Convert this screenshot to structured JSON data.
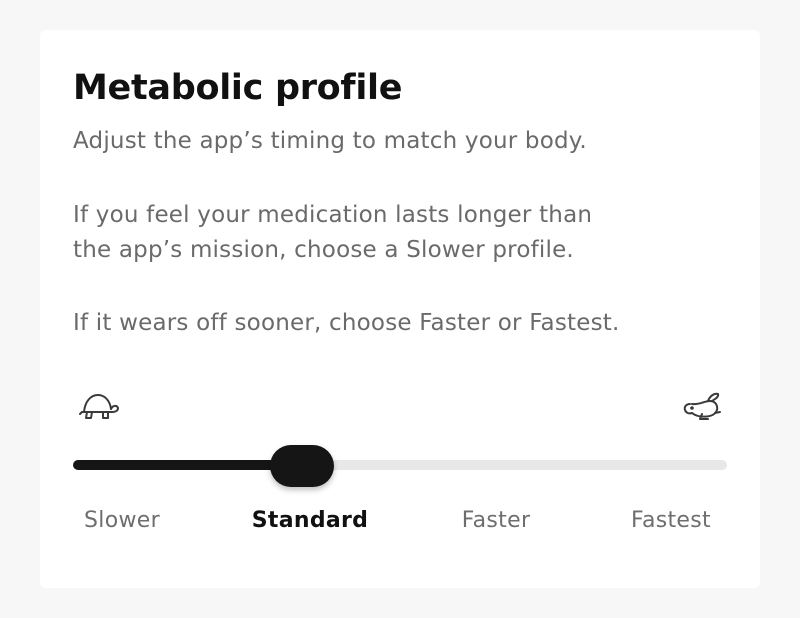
{
  "card": {
    "title": "Metabolic profile",
    "intro": "Adjust the app’s timing to match your body.",
    "slower_hint_line1": "If you feel your medication lasts longer than",
    "slower_hint_line2": "the app’s mission, choose a Slower profile.",
    "faster_hint": "If it wears off sooner, choose Faster or Fastest."
  },
  "slider": {
    "left_icon": "turtle-icon",
    "right_icon": "rabbit-icon",
    "options": [
      "Slower",
      "Standard",
      "Faster",
      "Fastest"
    ],
    "selected_index": 1,
    "selected_label": "Standard",
    "value_fraction": 0.35,
    "colors": {
      "active": "#151515",
      "track": "#e8e8e8",
      "label": "#6e6e6e"
    }
  }
}
